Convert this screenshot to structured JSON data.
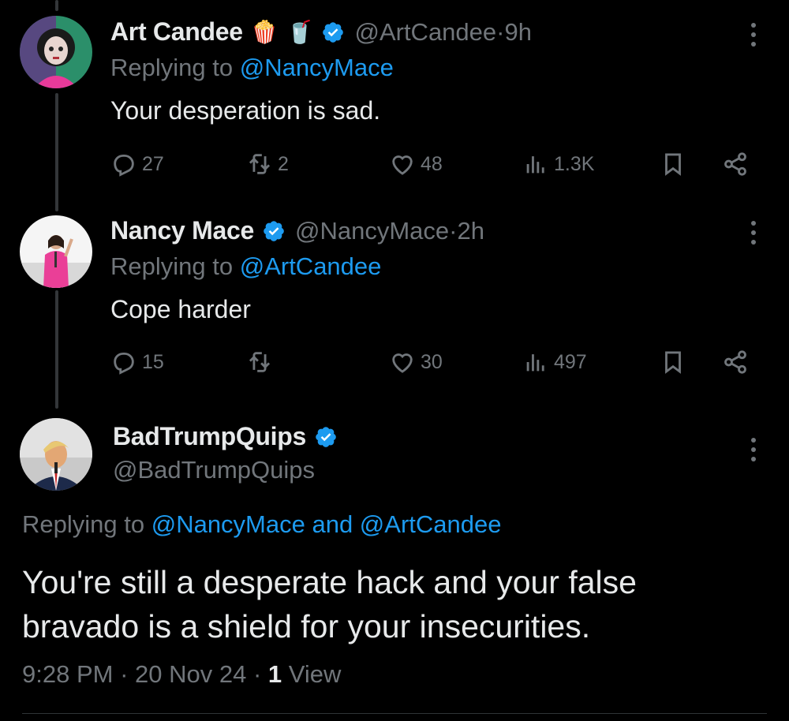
{
  "colors": {
    "background": "#000000",
    "text": "#e7e9ea",
    "muted": "#71767b",
    "link": "#1d9bf0",
    "verified": "#1d9bf0"
  },
  "tweets": [
    {
      "name": "Art Candee",
      "emojis": [
        "🍿",
        "🥤"
      ],
      "handle": "@ArtCandee",
      "time": "9h",
      "reply_prefix": "Replying to ",
      "reply_handle": "@NancyMace",
      "text": "Your desperation is sad.",
      "replies": "27",
      "reposts": "2",
      "likes": "48",
      "views": "1.3K"
    },
    {
      "name": "Nancy Mace",
      "handle": "@NancyMace",
      "time": "2h",
      "reply_prefix": "Replying to ",
      "reply_handle": "@ArtCandee",
      "text": "Cope harder",
      "replies": "15",
      "reposts": "",
      "likes": "30",
      "views": "497"
    }
  ],
  "main": {
    "name": "BadTrumpQuips",
    "handle": "@BadTrumpQuips",
    "reply_prefix": "Replying to ",
    "reply_handles": "@NancyMace and @ArtCandee",
    "text_line1": "You're still a desperate hack and your false",
    "text_line2": "bravado is a shield for your insecurities.",
    "time": "9:28 PM",
    "date": "20 Nov 24",
    "view_count": "1",
    "view_label": "View"
  },
  "separator": " · "
}
